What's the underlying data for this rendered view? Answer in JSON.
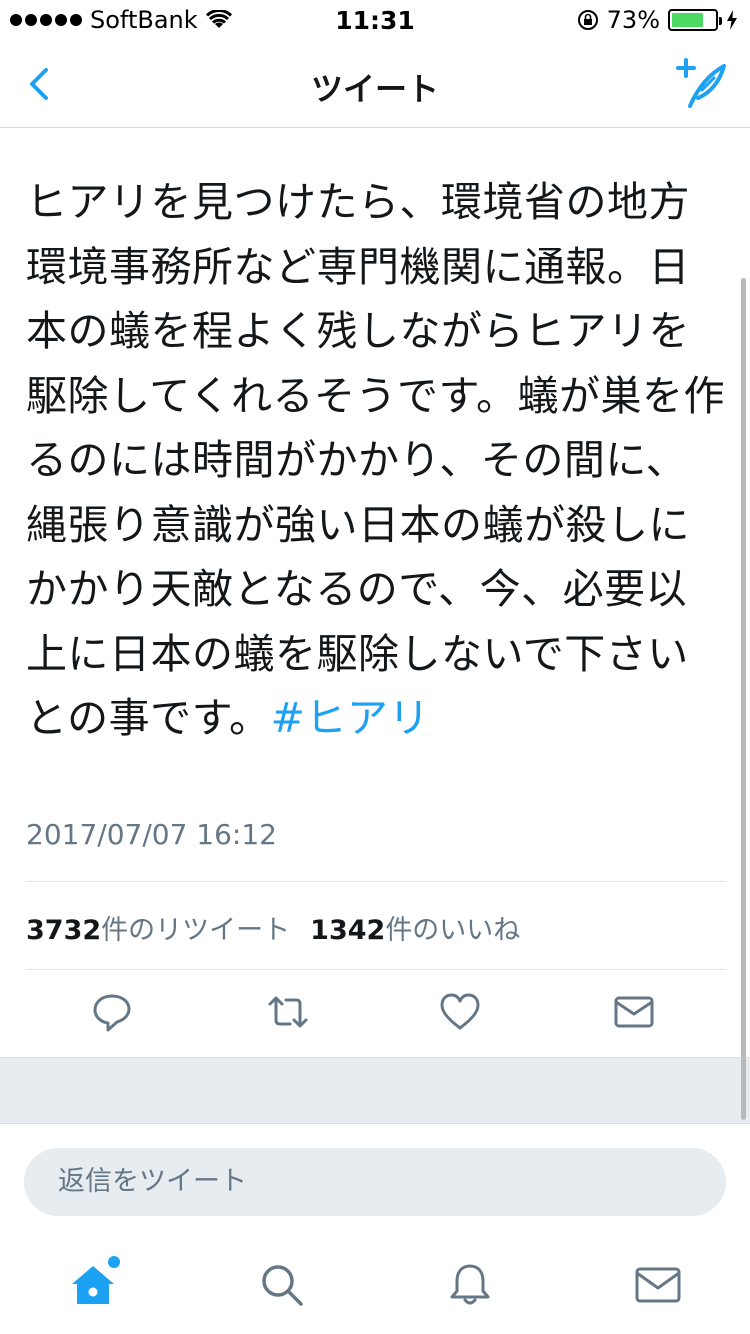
{
  "status_bar": {
    "carrier": "SoftBank",
    "time": "11:31",
    "battery_percent": "73%",
    "battery_level": 0.73
  },
  "nav": {
    "title": "ツイート"
  },
  "tweet": {
    "text": "ヒアリを見つけたら、環境省の地方環境事務所など専門機関に通報。日本の蟻を程よく残しながらヒアリを駆除してくれるそうです。蟻が巣を作るのには時間がかかり、その間に、縄張り意識が強い日本の蟻が殺しにかかり天敵となるので、今、必要以上に日本の蟻を駆除しないで下さいとの事です。",
    "hashtag": "#ヒアリ",
    "timestamp": "2017/07/07 16:12",
    "retweet_count": "3732",
    "retweet_label": "件のリツイート",
    "like_count": "1342",
    "like_label": "件のいいね"
  },
  "reply": {
    "placeholder": "返信をツイート"
  },
  "colors": {
    "accent": "#1da1f2",
    "secondary_text": "#657786",
    "band": "#e6ecf0"
  },
  "icons": {
    "back": "chevron-left-icon",
    "compose": "compose-tweet-icon",
    "reply": "reply-icon",
    "retweet": "retweet-icon",
    "like": "heart-icon",
    "dm": "envelope-icon",
    "home": "home-icon",
    "search": "search-icon",
    "notifications": "bell-icon",
    "messages": "envelope-icon"
  }
}
